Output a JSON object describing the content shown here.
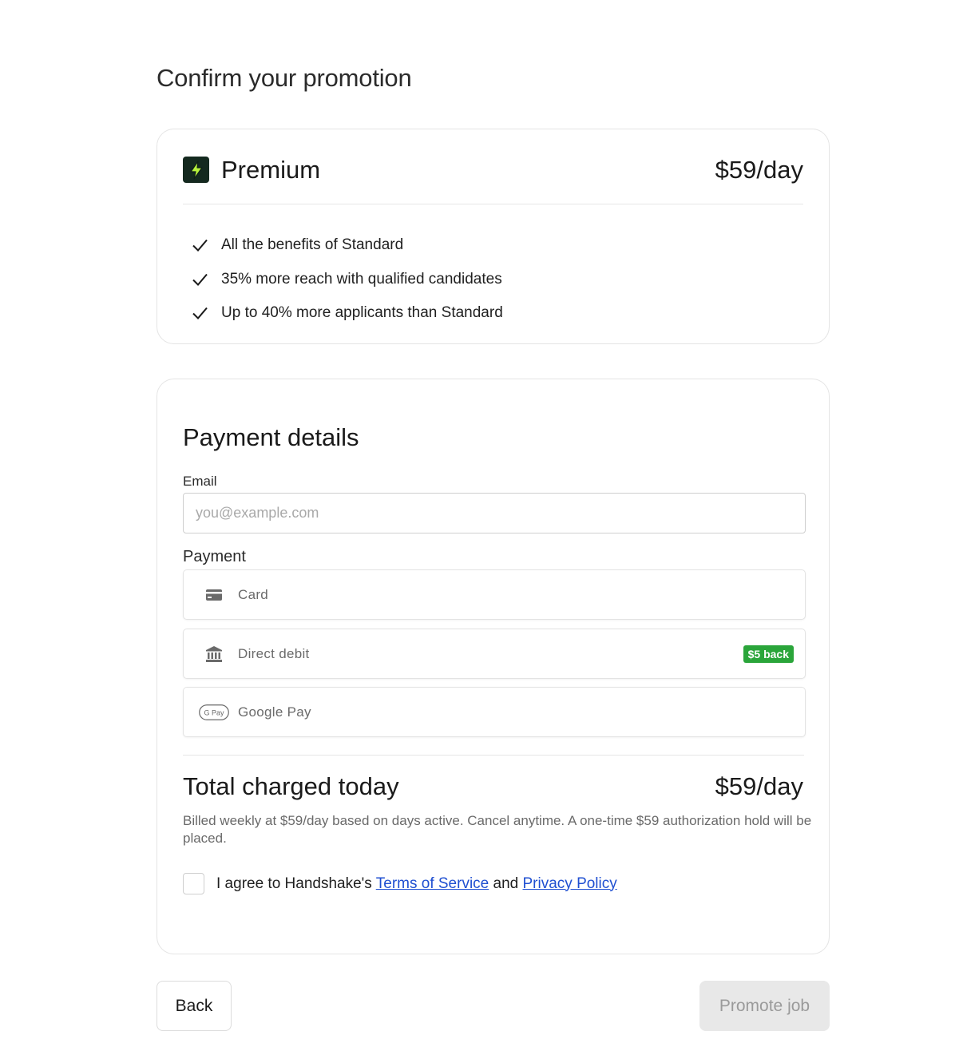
{
  "page": {
    "title": "Confirm your promotion"
  },
  "plan": {
    "name": "Premium",
    "price": "$59/day",
    "benefits": [
      "All the benefits of Standard",
      "35% more reach with qualified candidates",
      "Up to 40% more applicants than Standard"
    ]
  },
  "payment": {
    "title": "Payment details",
    "email_label": "Email",
    "email_placeholder": "you@example.com",
    "email_value": "",
    "payment_label": "Payment",
    "methods": [
      {
        "label": "Card",
        "icon": "credit-card-icon"
      },
      {
        "label": "Direct debit",
        "icon": "bank-icon",
        "badge": "$5 back"
      },
      {
        "label": "Google Pay",
        "icon": "google-pay-icon",
        "icon_text": "G Pay"
      }
    ]
  },
  "total": {
    "label": "Total charged today",
    "price": "$59/day",
    "note": "Billed weekly at $59/day based on days active. Cancel anytime. A one-time $59 authorization hold will be placed."
  },
  "agreement": {
    "prefix": "I agree to Handshake's ",
    "terms_label": "Terms of Service",
    "and": " and ",
    "privacy_label": "Privacy Policy",
    "checked": false
  },
  "actions": {
    "back_label": "Back",
    "promote_label": "Promote job"
  },
  "colors": {
    "accent_link": "#1f4fd1",
    "badge_green": "#2aa53a",
    "plan_icon_bg": "#14291f",
    "plan_icon_bolt": "#b6f23c"
  }
}
